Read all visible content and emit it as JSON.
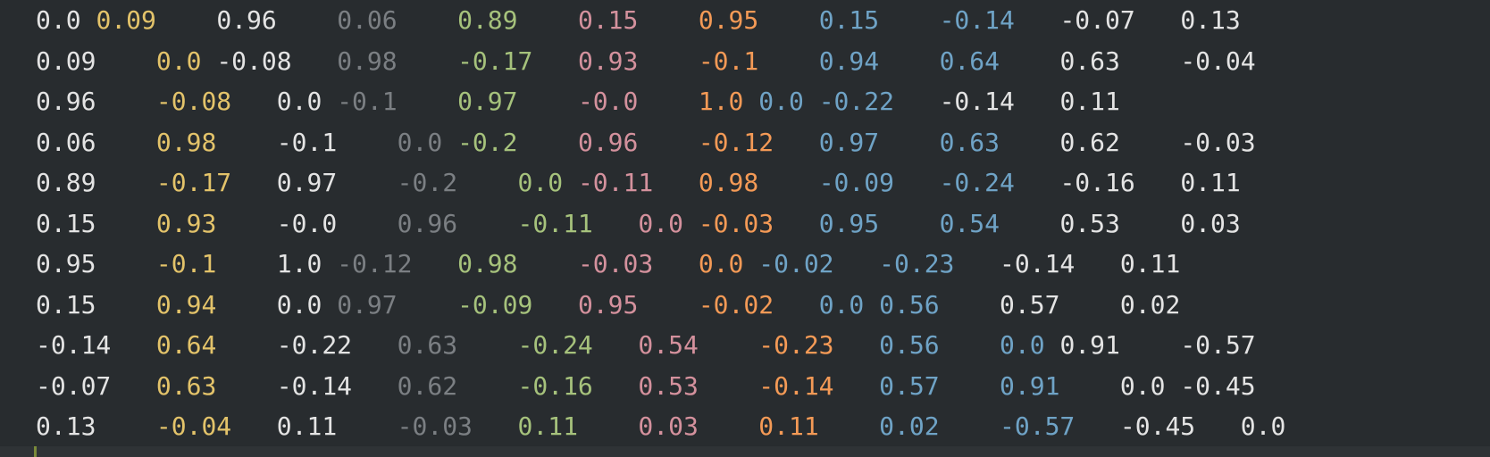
{
  "editor": {
    "rows": [
      [
        "0.0",
        "0.09",
        "0.96",
        "0.06",
        "0.89",
        "0.15",
        "0.95",
        "0.15",
        "-0.14",
        "-0.07",
        "0.13"
      ],
      [
        "0.09",
        "0.0",
        "-0.08",
        "0.98",
        "-0.17",
        "0.93",
        "-0.1",
        "0.94",
        "0.64",
        "0.63",
        "-0.04"
      ],
      [
        "0.96",
        "-0.08",
        "0.0",
        "-0.1",
        "0.97",
        "-0.0",
        "1.0",
        "0.0",
        "-0.22",
        "-0.14",
        "0.11"
      ],
      [
        "0.06",
        "0.98",
        "-0.1",
        "0.0",
        "-0.2",
        "0.96",
        "-0.12",
        "0.97",
        "0.63",
        "0.62",
        "-0.03"
      ],
      [
        "0.89",
        "-0.17",
        "0.97",
        "-0.2",
        "0.0",
        "-0.11",
        "0.98",
        "-0.09",
        "-0.24",
        "-0.16",
        "0.11"
      ],
      [
        "0.15",
        "0.93",
        "-0.0",
        "0.96",
        "-0.11",
        "0.0",
        "-0.03",
        "0.95",
        "0.54",
        "0.53",
        "0.03"
      ],
      [
        "0.95",
        "-0.1",
        "1.0",
        "-0.12",
        "0.98",
        "-0.03",
        "0.0",
        "-0.02",
        "-0.23",
        "-0.14",
        "0.11"
      ],
      [
        "0.15",
        "0.94",
        "0.0",
        "0.97",
        "-0.09",
        "0.95",
        "-0.02",
        "0.0",
        "0.56",
        "0.57",
        "0.02"
      ],
      [
        "-0.14",
        "0.64",
        "-0.22",
        "0.63",
        "-0.24",
        "0.54",
        "-0.23",
        "0.56",
        "0.0",
        "0.91",
        "-0.57"
      ],
      [
        "-0.07",
        "0.63",
        "-0.14",
        "0.62",
        "-0.16",
        "0.53",
        "-0.14",
        "0.57",
        "0.91",
        "0.0",
        "-0.45"
      ],
      [
        "0.13",
        "-0.04",
        "0.11",
        "-0.03",
        "0.11",
        "0.03",
        "0.11",
        "0.02",
        "-0.57",
        "-0.45",
        "0.0"
      ]
    ],
    "column_colors": [
      "#e4e4e4",
      "#e3c36a",
      "#e4e4e4",
      "#7b7f83",
      "#a6c27c",
      "#d4919d",
      "#f49a56",
      "#6fa3c6",
      "#6fa3c6",
      "#e4e4e4",
      "#e4e4e4"
    ],
    "background": "#282c2f"
  }
}
